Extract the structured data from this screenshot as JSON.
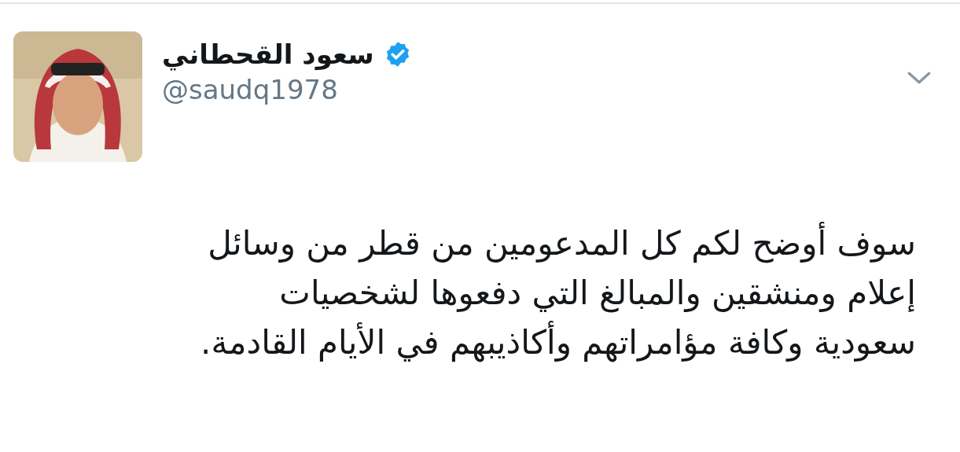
{
  "author": {
    "name": "سعود القحطاني",
    "verified": true,
    "handle": "@saudq1978"
  },
  "tweet": {
    "lines": [
      "سوف أوضح لكم كل المدعومين من قطر من وسائل",
      "إعلام ومنشقين والمبالغ التي دفعوها لشخصيات",
      "سعودية وكافة مؤامراتهم وأكاذيبهم في الأيام القادمة."
    ]
  }
}
